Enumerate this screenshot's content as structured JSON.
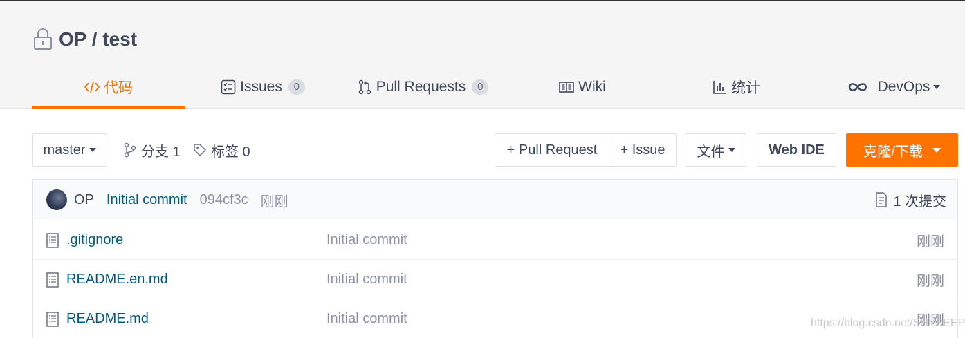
{
  "repo": {
    "title": "OP / test"
  },
  "tabs": [
    {
      "label": "代码",
      "icon": "code-icon",
      "active": true
    },
    {
      "label": "Issues",
      "icon": "issues-icon",
      "count": "0"
    },
    {
      "label": "Pull Requests",
      "icon": "pull-request-icon",
      "count": "0"
    },
    {
      "label": "Wiki",
      "icon": "book-icon"
    },
    {
      "label": "统计",
      "icon": "bar-chart-icon"
    },
    {
      "label": "DevOps",
      "icon": "infinity-icon",
      "dropdown": true
    }
  ],
  "toolbar": {
    "branch": "master",
    "branches_label": "分支 1",
    "tags_label": "标签 0",
    "pull_request_button": "+ Pull Request",
    "issue_button": "+ Issue",
    "file_button": "文件",
    "web_ide_button": "Web IDE",
    "clone_button": "克隆/下载"
  },
  "latest_commit": {
    "author": "OP",
    "message": "Initial commit",
    "hash": "094cf3c",
    "time": "刚刚",
    "commits_label": "1 次提交"
  },
  "files": [
    {
      "name": ".gitignore",
      "message": "Initial commit",
      "time": "刚刚"
    },
    {
      "name": "README.en.md",
      "message": "Initial commit",
      "time": "刚刚"
    },
    {
      "name": "README.md",
      "message": "Initial commit",
      "time": "刚刚"
    }
  ],
  "watermark": "https://blog.csdn.net/SHYSEEP",
  "colors": {
    "accent": "#fe7300",
    "link": "#005980",
    "text": "#40485b",
    "muted": "#8c92a4"
  }
}
